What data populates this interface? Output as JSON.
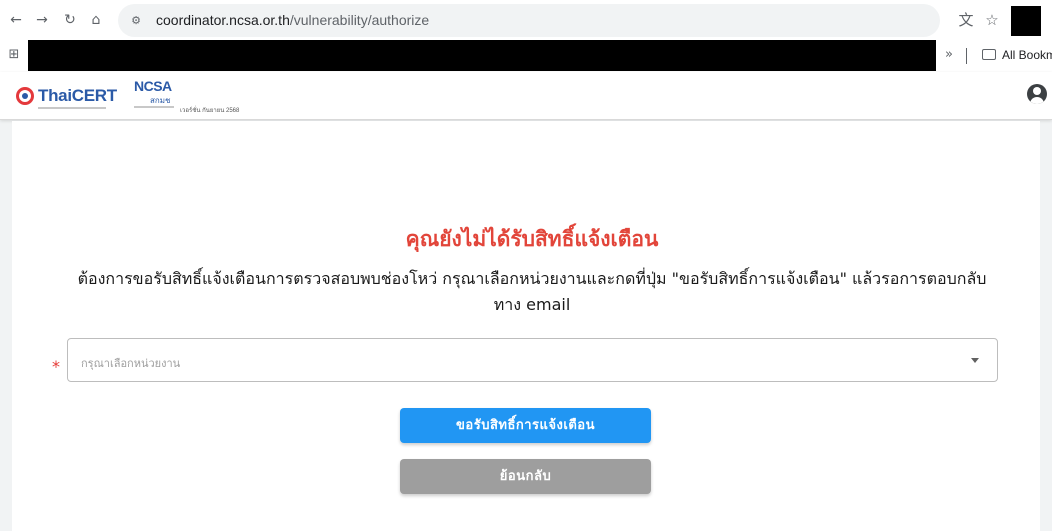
{
  "browser": {
    "url_domain": "coordinator.ncsa.or.th",
    "url_path": "/vulnerability/authorize",
    "icons": [
      "back-arrow-icon",
      "forward-arrow-icon",
      "reload-icon",
      "home-icon",
      "site-settings-icon",
      "translate-icon",
      "star-icon"
    ],
    "bookmarks_label": "All Bookmar"
  },
  "header": {
    "thaicert_logo": "ThaiCERT",
    "ncsa_logo": "NCSA",
    "ncsa_thai": "สกมช",
    "version": "เวอร์ชั่น กันยายน 2568"
  },
  "main": {
    "title": "คุณยังไม่ได้รับสิทธิ์แจ้งเตือน",
    "description": "ต้องการขอรับสิทธิ์แจ้งเตือนการตรวจสอบพบช่องโหว่ กรุณาเลือกหน่วยงานและกดที่ปุ่ม \"ขอรับสิทธิ์การแจ้งเตือน\" แล้วรอการตอบกลับทาง email",
    "required_mark": "*",
    "select_placeholder": "กรุณาเลือกหน่วยงาน",
    "request_button": "ขอรับสิทธิ์การแจ้งเตือน",
    "back_button": "ย้อนกลับ"
  },
  "colors": {
    "title": "#e2453a",
    "primary_button": "#2196f3",
    "secondary_button": "#9e9e9e",
    "required": "#e53935"
  }
}
